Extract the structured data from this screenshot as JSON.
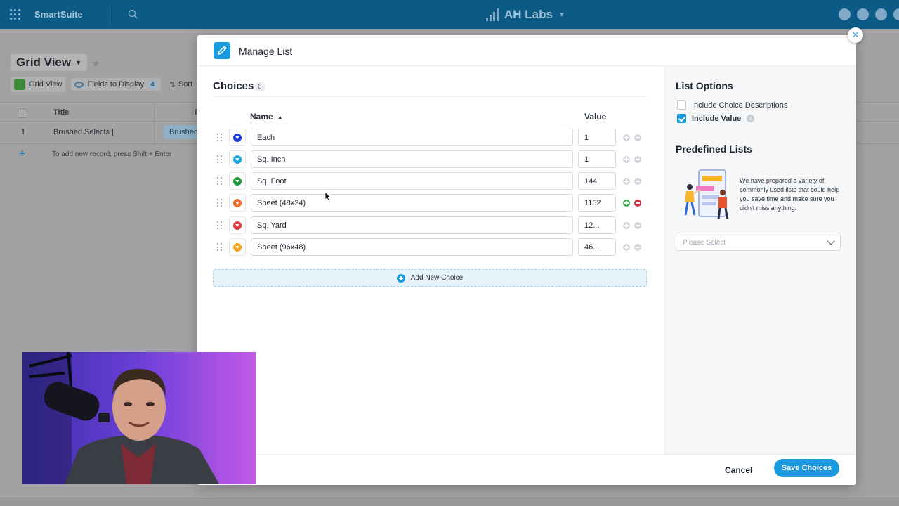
{
  "app": {
    "brand": "SmartSuite",
    "workspace": "AH Labs"
  },
  "background": {
    "view_title": "Grid View",
    "toolbar": {
      "grid_view": "Grid View",
      "fields_to_display": "Fields to Display",
      "fields_count": "4",
      "sort": "Sort"
    },
    "grid": {
      "columns": [
        "Title",
        "F"
      ],
      "rows": [
        {
          "num": "1",
          "title": "Brushed Selects |",
          "chip": "Brushed"
        }
      ],
      "add_hint": "To add new record, press Shift + Enter"
    }
  },
  "modal": {
    "title": "Manage List",
    "choices_title": "Choices",
    "choices_count": "6",
    "col_name": "Name",
    "col_value": "Value",
    "choices": [
      {
        "name": "Each",
        "value": "1",
        "color": "#1e3fd6"
      },
      {
        "name": "Sq. Inch",
        "value": "1",
        "color": "#1ea8e8"
      },
      {
        "name": "Sq. Foot",
        "value": "144",
        "color": "#1f9a3c"
      },
      {
        "name": "Sheet (48x24)",
        "value": "1152",
        "color": "#f06d2b"
      },
      {
        "name": "Sq. Yard",
        "value": "12...",
        "color": "#e23b44"
      },
      {
        "name": "Sheet (96x48)",
        "value": "46...",
        "color": "#f4a41c"
      }
    ],
    "add_choice": "Add New Choice",
    "list_options_title": "List Options",
    "options": {
      "include_descriptions": "Include Choice Descriptions",
      "include_value": "Include Value"
    },
    "predefined_title": "Predefined Lists",
    "predefined_text": "We have prepared a variety of commonly used lists that could help you save time and make sure you didn't miss anything.",
    "select_placeholder": "Please Select",
    "cancel": "Cancel",
    "save": "Save Choices"
  },
  "colors": {
    "accent": "#1a9be0",
    "topbar": "#0c5a86",
    "add_green": "#3ab54a",
    "remove_red": "#d9303e"
  }
}
